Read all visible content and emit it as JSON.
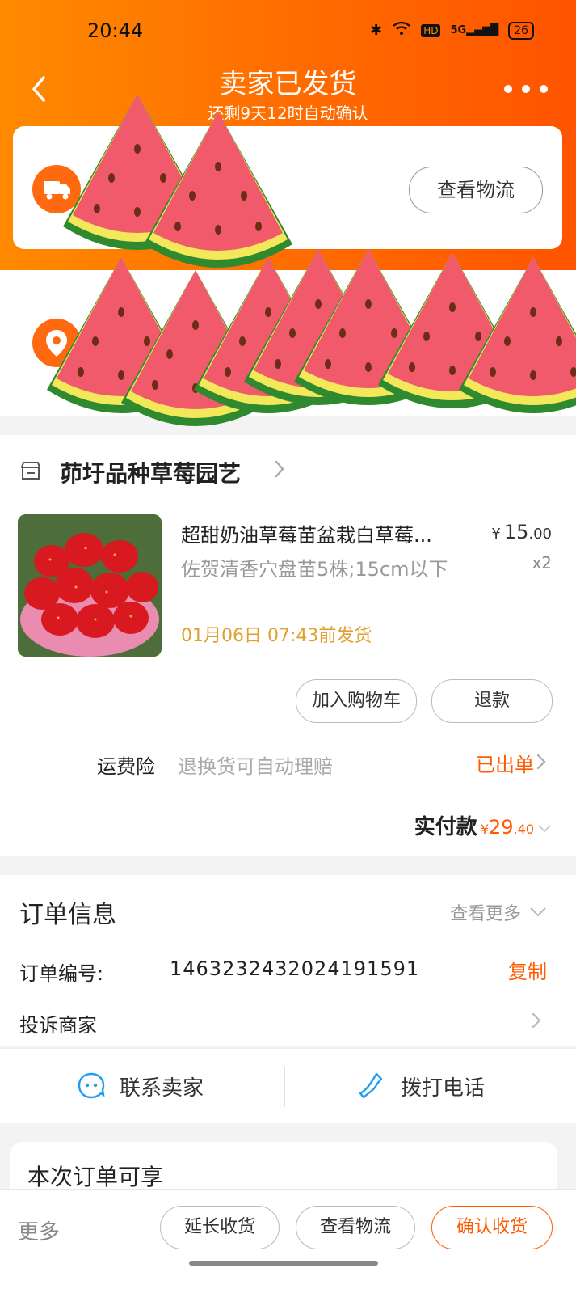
{
  "status_bar": {
    "time": "20:44",
    "network": "5G",
    "hd": "HD",
    "battery": "26"
  },
  "header": {
    "title": "卖家已发货",
    "subtitle": "还剩9天12时自动确认"
  },
  "logistics": {
    "track_label": "查看物流"
  },
  "shop": {
    "name": "茆圩品种草莓园艺"
  },
  "product": {
    "title": "超甜奶油草莓苗盆栽白草莓...",
    "sku": "佐贺清香穴盘苗5株;15cm以下",
    "ship_deadline": "01月06日 07:43前发货",
    "price_yen": "¥",
    "price_int": "15",
    "price_cents": ".00",
    "qty": "x2",
    "add_cart_label": "加入购物车",
    "refund_label": "退款"
  },
  "insurance": {
    "label": "运费险",
    "desc": "退换货可自动理赔",
    "status": "已出单"
  },
  "payment": {
    "label": "实付款",
    "yen": "¥",
    "amount_int": "29",
    "amount_cents": ".40"
  },
  "order_info": {
    "title": "订单信息",
    "view_more": "查看更多",
    "order_no_label": "订单编号:",
    "order_no": "1463232432024191591",
    "copy_label": "复制",
    "complain_label": "投诉商家"
  },
  "contact": {
    "seller_label": "联系卖家",
    "phone_label": "拨打电话"
  },
  "benefits": {
    "title": "本次订单可享"
  },
  "bottom_bar": {
    "more_label": "更多",
    "extend_label": "延长收货",
    "track_label": "查看物流",
    "confirm_label": "确认收货"
  },
  "colors": {
    "accent": "#ff5a00",
    "header_start": "#ff8a00",
    "header_end": "#ff5400",
    "watermelon_flesh": "#f05a6a",
    "watermelon_rind": "#2f8a2f"
  }
}
